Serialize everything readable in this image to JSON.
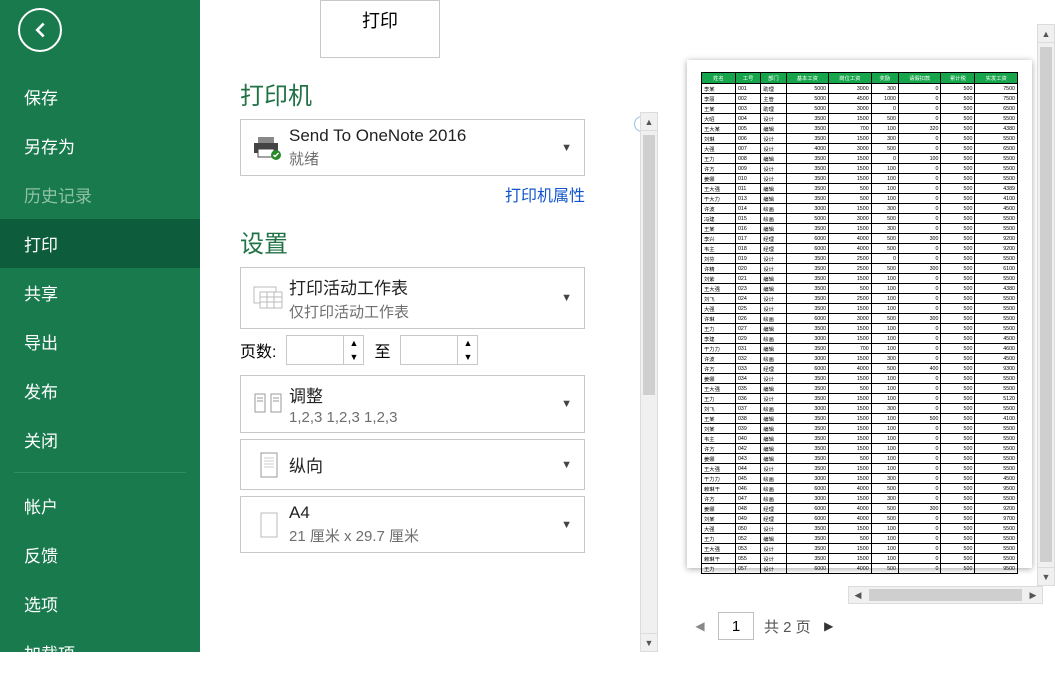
{
  "sidebar": {
    "items": [
      {
        "label": "保存",
        "name": "save",
        "disabled": false
      },
      {
        "label": "另存为",
        "name": "save-as",
        "disabled": false
      },
      {
        "label": "历史记录",
        "name": "history",
        "disabled": true
      },
      {
        "label": "打印",
        "name": "print",
        "disabled": false,
        "active": true
      },
      {
        "label": "共享",
        "name": "share",
        "disabled": false
      },
      {
        "label": "导出",
        "name": "export",
        "disabled": false
      },
      {
        "label": "发布",
        "name": "publish",
        "disabled": false
      },
      {
        "label": "关闭",
        "name": "close",
        "disabled": false
      }
    ],
    "footer": [
      {
        "label": "帐户",
        "name": "account"
      },
      {
        "label": "反馈",
        "name": "feedback"
      },
      {
        "label": "选项",
        "name": "options"
      },
      {
        "label": "加载项",
        "name": "addins",
        "caret": true
      }
    ]
  },
  "print": {
    "button_label": "打印",
    "printer_section": "打印机",
    "printer_name": "Send To OneNote 2016",
    "printer_status": "就绪",
    "printer_props": "打印机属性",
    "settings_section": "设置",
    "print_what_title": "打印活动工作表",
    "print_what_sub": "仅打印活动工作表",
    "pages_label": "页数:",
    "pages_from": "",
    "pages_to_label": "至",
    "pages_to": "",
    "collate_title": "调整",
    "collate_sub": "1,2,3    1,2,3    1,2,3",
    "orientation": "纵向",
    "paper_title": "A4",
    "paper_sub": "21 厘米 x 29.7 厘米"
  },
  "pager": {
    "current": "1",
    "total": "共 2 页"
  },
  "preview": {
    "headers": [
      "姓名",
      "工号",
      "部门",
      "基本工资",
      "岗位工资",
      "奖励",
      "请假扣款",
      "累计税",
      "实发工资"
    ],
    "rows": [
      [
        "李某",
        "001",
        "助理",
        "5000",
        "3000",
        "300",
        "0",
        "500",
        "7500"
      ],
      [
        "李丽",
        "002",
        "主管",
        "5000",
        "4500",
        "1000",
        "0",
        "500",
        "7500"
      ],
      [
        "王某",
        "003",
        "助理",
        "5000",
        "3000",
        "0",
        "0",
        "500",
        "6500"
      ],
      [
        "大昭",
        "004",
        "设计",
        "3500",
        "1500",
        "500",
        "0",
        "500",
        "5500"
      ],
      [
        "王大某",
        "005",
        "编辑",
        "3500",
        "700",
        "100",
        "320",
        "500",
        "4380"
      ],
      [
        "刘琳",
        "006",
        "设计",
        "3500",
        "1500",
        "300",
        "0",
        "500",
        "5500"
      ],
      [
        "大强",
        "007",
        "设计",
        "4000",
        "3000",
        "500",
        "0",
        "500",
        "6500"
      ],
      [
        "王力",
        "008",
        "编辑",
        "3500",
        "1500",
        "0",
        "100",
        "500",
        "5500"
      ],
      [
        "许方",
        "009",
        "设计",
        "3500",
        "1500",
        "100",
        "0",
        "500",
        "5500"
      ],
      [
        "姜娜",
        "010",
        "设计",
        "3500",
        "1500",
        "100",
        "0",
        "500",
        "5500"
      ],
      [
        "王大强",
        "011",
        "编辑",
        "3500",
        "500",
        "100",
        "0",
        "500",
        "4389"
      ],
      [
        "干大力",
        "013",
        "编辑",
        "3500",
        "500",
        "100",
        "0",
        "500",
        "4100"
      ],
      [
        "许波",
        "014",
        "绘画",
        "3000",
        "1500",
        "300",
        "0",
        "500",
        "4500"
      ],
      [
        "冯建",
        "015",
        "绘画",
        "5000",
        "3000",
        "500",
        "0",
        "500",
        "5500"
      ],
      [
        "王某",
        "016",
        "编辑",
        "3500",
        "1500",
        "300",
        "0",
        "500",
        "5500"
      ],
      [
        "李兴",
        "017",
        "经理",
        "6000",
        "4000",
        "500",
        "300",
        "500",
        "9200"
      ],
      [
        "韦主",
        "018",
        "经理",
        "6000",
        "4000",
        "500",
        "0",
        "500",
        "9200"
      ],
      [
        "刘芬",
        "019",
        "设计",
        "3500",
        "2500",
        "0",
        "0",
        "500",
        "5500"
      ],
      [
        "许精",
        "020",
        "设计",
        "3500",
        "2500",
        "500",
        "300",
        "500",
        "6100"
      ],
      [
        "刘紫",
        "021",
        "编辑",
        "3500",
        "1500",
        "100",
        "0",
        "500",
        "5500"
      ],
      [
        "王大强",
        "023",
        "编辑",
        "3500",
        "500",
        "100",
        "0",
        "500",
        "4380"
      ],
      [
        "刘飞",
        "024",
        "设计",
        "3500",
        "2500",
        "100",
        "0",
        "500",
        "5500"
      ],
      [
        "大强",
        "025",
        "设计",
        "3500",
        "1500",
        "100",
        "0",
        "500",
        "5500"
      ],
      [
        "许琳",
        "026",
        "绘画",
        "6000",
        "3000",
        "500",
        "300",
        "500",
        "5500"
      ],
      [
        "王力",
        "027",
        "编辑",
        "3500",
        "1500",
        "100",
        "0",
        "500",
        "5500"
      ],
      [
        "李建",
        "029",
        "绘画",
        "3000",
        "1500",
        "100",
        "0",
        "500",
        "4500"
      ],
      [
        "干力力",
        "031",
        "编辑",
        "3500",
        "700",
        "100",
        "0",
        "500",
        "4600"
      ],
      [
        "许波",
        "032",
        "绘画",
        "3000",
        "1500",
        "300",
        "0",
        "500",
        "4500"
      ],
      [
        "许方",
        "033",
        "经理",
        "6000",
        "4000",
        "500",
        "400",
        "500",
        "9300"
      ],
      [
        "姜娜",
        "034",
        "设计",
        "3500",
        "1500",
        "100",
        "0",
        "500",
        "5500"
      ],
      [
        "王大强",
        "035",
        "编辑",
        "3500",
        "500",
        "100",
        "0",
        "500",
        "5500"
      ],
      [
        "王力",
        "036",
        "设计",
        "3500",
        "1500",
        "100",
        "0",
        "500",
        "5120"
      ],
      [
        "刘飞",
        "037",
        "绘画",
        "3000",
        "1500",
        "300",
        "0",
        "500",
        "5500"
      ],
      [
        "王某",
        "038",
        "编辑",
        "3500",
        "1500",
        "100",
        "500",
        "500",
        "4100"
      ],
      [
        "刘某",
        "039",
        "编辑",
        "3500",
        "1500",
        "100",
        "0",
        "500",
        "5500"
      ],
      [
        "韦主",
        "040",
        "编辑",
        "3500",
        "1500",
        "100",
        "0",
        "500",
        "5500"
      ],
      [
        "许方",
        "042",
        "编辑",
        "3500",
        "1500",
        "100",
        "0",
        "500",
        "5500"
      ],
      [
        "姜娜",
        "043",
        "编辑",
        "3500",
        "500",
        "100",
        "0",
        "500",
        "5500"
      ],
      [
        "王大强",
        "044",
        "设计",
        "3500",
        "1500",
        "100",
        "0",
        "500",
        "5500"
      ],
      [
        "干力力",
        "045",
        "绘画",
        "3000",
        "1500",
        "300",
        "0",
        "500",
        "4500"
      ],
      [
        "赖琳干",
        "046",
        "绘画",
        "6000",
        "4000",
        "500",
        "0",
        "500",
        "9500"
      ],
      [
        "许方",
        "047",
        "绘画",
        "3000",
        "1500",
        "300",
        "0",
        "500",
        "5500"
      ],
      [
        "姜娜",
        "048",
        "经理",
        "6000",
        "4000",
        "500",
        "300",
        "500",
        "9200"
      ],
      [
        "刘某",
        "049",
        "经理",
        "6000",
        "4000",
        "500",
        "0",
        "500",
        "9700"
      ],
      [
        "大强",
        "050",
        "设计",
        "3500",
        "1500",
        "100",
        "0",
        "500",
        "5500"
      ],
      [
        "王力",
        "052",
        "编辑",
        "3500",
        "500",
        "100",
        "0",
        "500",
        "5500"
      ],
      [
        "王大强",
        "053",
        "设计",
        "3500",
        "1500",
        "100",
        "0",
        "500",
        "5500"
      ],
      [
        "赖琳干",
        "055",
        "设计",
        "3500",
        "1500",
        "100",
        "0",
        "500",
        "5500"
      ],
      [
        "王力",
        "057",
        "设计",
        "6000",
        "4000",
        "500",
        "0",
        "500",
        "9500"
      ]
    ]
  }
}
